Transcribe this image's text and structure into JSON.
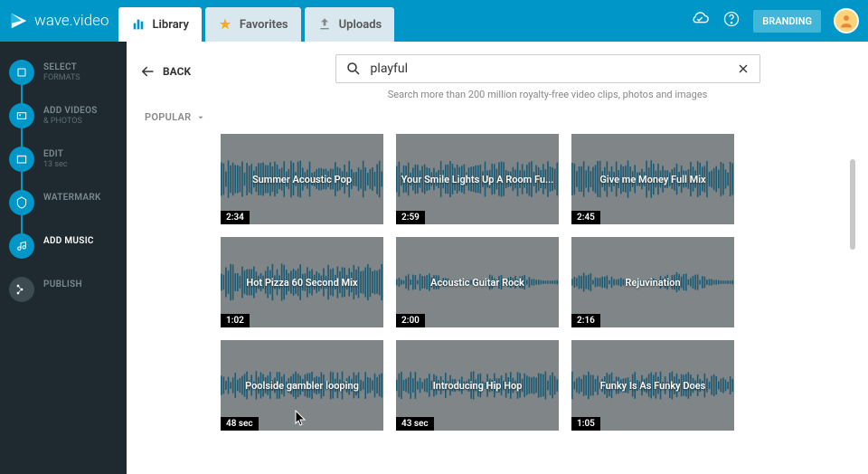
{
  "brand": "wave.video",
  "tabs": [
    {
      "label": "Library",
      "active": true
    },
    {
      "label": "Favorites",
      "active": false
    },
    {
      "label": "Uploads",
      "active": false
    }
  ],
  "header": {
    "branding": "BRANDING"
  },
  "sidebar": {
    "items": [
      {
        "title": "SELECT",
        "sub": "FORMATS"
      },
      {
        "title": "ADD VIDEOS",
        "sub": "& PHOTOS"
      },
      {
        "title": "EDIT",
        "sub": "13 sec"
      },
      {
        "title": "WATERMARK",
        "sub": ""
      },
      {
        "title": "ADD MUSIC",
        "sub": ""
      },
      {
        "title": "PUBLISH",
        "sub": ""
      }
    ],
    "activeIndex": 4
  },
  "back": "BACK",
  "search": {
    "value": "playful",
    "hint": "Search more than 200 million royalty-free video clips, photos and images"
  },
  "filter": "POPULAR",
  "tracks": [
    {
      "title": "Summer Acoustic Pop",
      "dur": "2:34",
      "fill": "dense"
    },
    {
      "title": "Your Smile Lights Up A Room Fu...",
      "dur": "2:59",
      "fill": "dense"
    },
    {
      "title": "Give me Money Full Mix",
      "dur": "2:45",
      "fill": "dense"
    },
    {
      "title": "Hot Pizza 60 Second Mix",
      "dur": "1:02",
      "fill": "dense"
    },
    {
      "title": "Acoustic Guitar Rock",
      "dur": "2:00",
      "fill": "sparse"
    },
    {
      "title": "Rejuvination",
      "dur": "2:16",
      "fill": "sparse"
    },
    {
      "title": "Poolside gambler looping",
      "dur": "48 sec",
      "fill": "mid"
    },
    {
      "title": "Introducing Hip Hop",
      "dur": "43 sec",
      "fill": "mid"
    },
    {
      "title": "Funky Is As Funky Does",
      "dur": "1:05",
      "fill": "mid"
    }
  ]
}
